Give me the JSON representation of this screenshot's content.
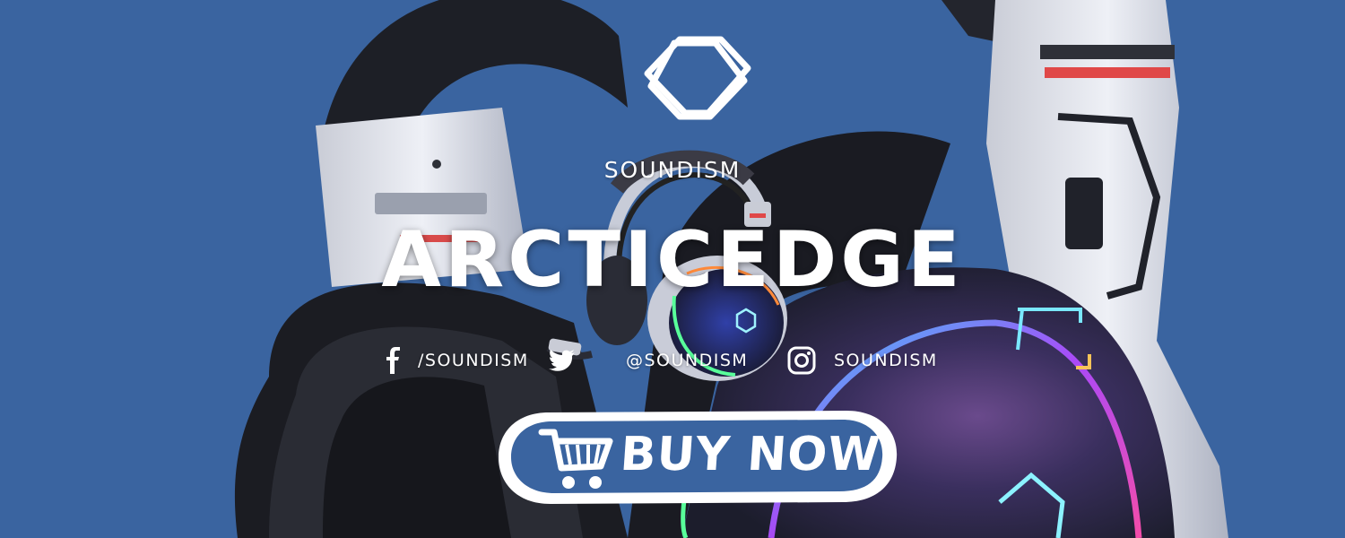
{
  "brand": {
    "name": "SOUNDISM",
    "product_name": "ARCTICEDGE"
  },
  "social": [
    {
      "platform": "facebook",
      "icon": "facebook-icon",
      "handle": "/SOUNDISM"
    },
    {
      "platform": "twitter",
      "icon": "twitter-icon",
      "handle": "@SOUNDISM"
    },
    {
      "platform": "instagram",
      "icon": "instagram-icon",
      "handle": "SOUNDISM"
    }
  ],
  "cta": {
    "label": "BUY NOW",
    "icon": "shopping-cart-icon"
  },
  "colors": {
    "background": "#3a64a0",
    "button_fill": "#3a64a0",
    "text": "#ffffff"
  }
}
